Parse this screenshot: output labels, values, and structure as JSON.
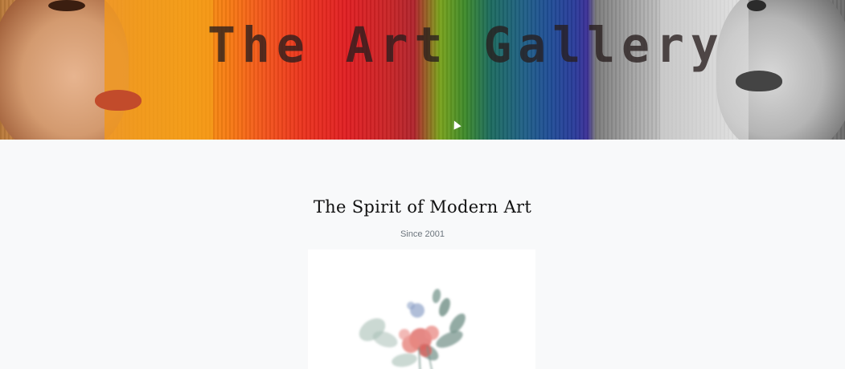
{
  "hero": {
    "title": "The Art Gallery"
  },
  "intro": {
    "headline": "The Spirit of Modern Art",
    "subline": "Since 2001"
  },
  "artwork": {
    "subject": "watercolor flower bouquet",
    "colors": {
      "petal": "#e0736f",
      "leaf": "#6f8f86",
      "leaf_light": "#a9bfb6",
      "accent_blue": "#8fa3c8"
    }
  }
}
